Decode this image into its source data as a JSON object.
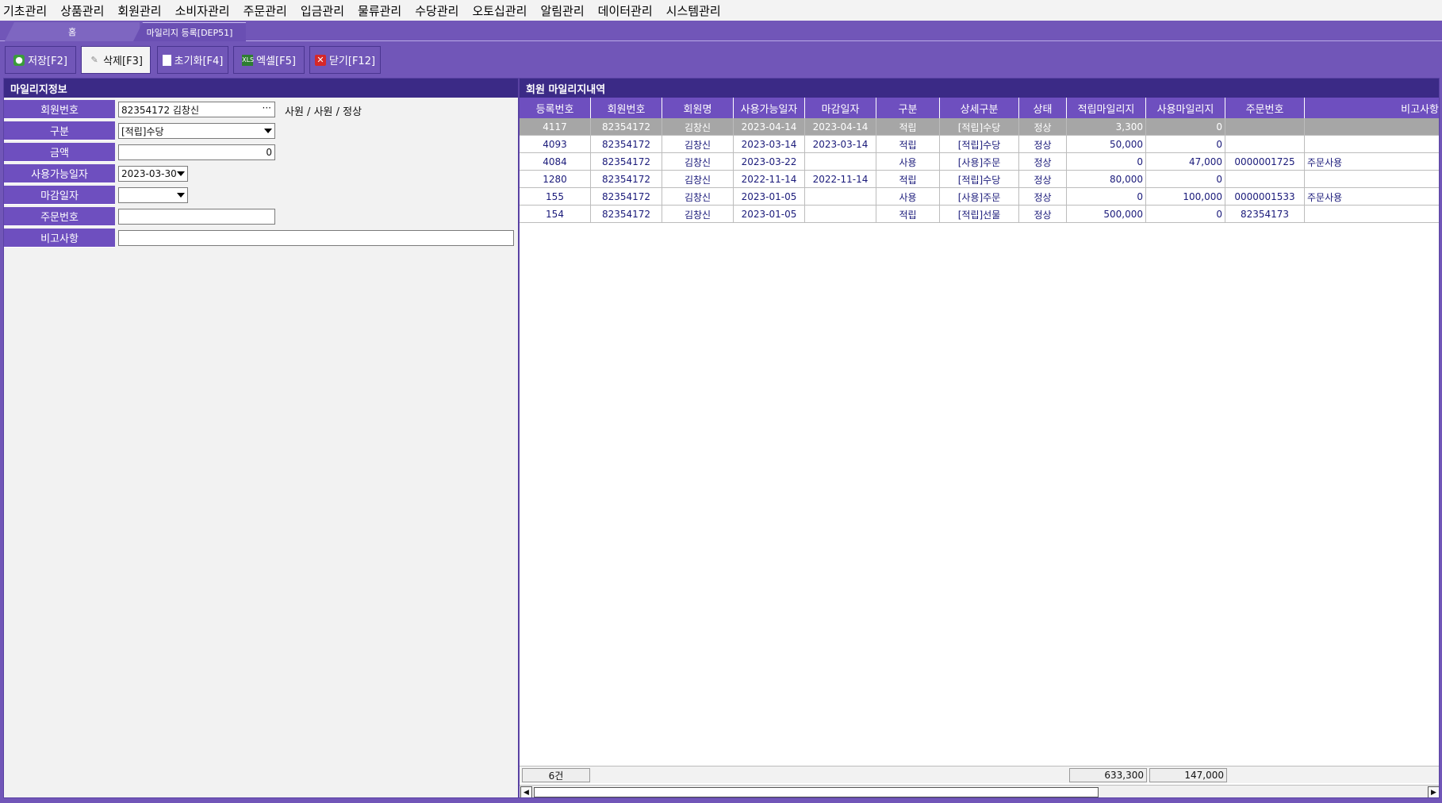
{
  "menu": [
    "기초관리",
    "상품관리",
    "회원관리",
    "소비자관리",
    "주문관리",
    "입금관리",
    "물류관리",
    "수당관리",
    "오토십관리",
    "알림관리",
    "데이터관리",
    "시스템관리"
  ],
  "tabs": {
    "home": "홈",
    "active": "마일리지 등록[DEP51]"
  },
  "toolbar": {
    "save": "저장[F2]",
    "delete": "삭제[F3]",
    "reset": "초기화[F4]",
    "excel": "엑셀[F5]",
    "close": "닫기[F12]"
  },
  "form": {
    "title": "마일리지정보",
    "member_no_label": "회원번호",
    "member_no_value": "82354172 김창신",
    "member_status": "사원 / 사원 / 정상",
    "type_label": "구분",
    "type_value": "[적립]수당",
    "amount_label": "금액",
    "amount_value": "0",
    "avail_date_label": "사용가능일자",
    "avail_date_value": "2023-03-30",
    "close_date_label": "마감일자",
    "close_date_value": "",
    "order_no_label": "주문번호",
    "order_no_value": "",
    "memo_label": "비고사항",
    "memo_value": ""
  },
  "grid": {
    "title": "회원 마일리지내역",
    "columns": [
      "등록번호",
      "회원번호",
      "회원명",
      "사용가능일자",
      "마감일자",
      "구분",
      "상세구분",
      "상태",
      "적립마일리지",
      "사용마일리지",
      "주문번호",
      "비고사항"
    ],
    "rows": [
      [
        "4117",
        "82354172",
        "김창신",
        "2023-04-14",
        "2023-04-14",
        "적립",
        "[적립]수당",
        "정상",
        "3,300",
        "0",
        "",
        ""
      ],
      [
        "4093",
        "82354172",
        "김창신",
        "2023-03-14",
        "2023-03-14",
        "적립",
        "[적립]수당",
        "정상",
        "50,000",
        "0",
        "",
        ""
      ],
      [
        "4084",
        "82354172",
        "김창신",
        "2023-03-22",
        "",
        "사용",
        "[사용]주문",
        "정상",
        "0",
        "47,000",
        "0000001725",
        "주문사용"
      ],
      [
        "1280",
        "82354172",
        "김창신",
        "2022-11-14",
        "2022-11-14",
        "적립",
        "[적립]수당",
        "정상",
        "80,000",
        "0",
        "",
        ""
      ],
      [
        "155",
        "82354172",
        "김창신",
        "2023-01-05",
        "",
        "사용",
        "[사용]주문",
        "정상",
        "0",
        "100,000",
        "0000001533",
        "주문사용"
      ],
      [
        "154",
        "82354172",
        "김창신",
        "2023-01-05",
        "",
        "적립",
        "[적립]선물",
        "정상",
        "500,000",
        "0",
        "82354173",
        ""
      ]
    ],
    "footer": {
      "count": "6건",
      "total_earned": "633,300",
      "total_used": "147,000"
    }
  }
}
